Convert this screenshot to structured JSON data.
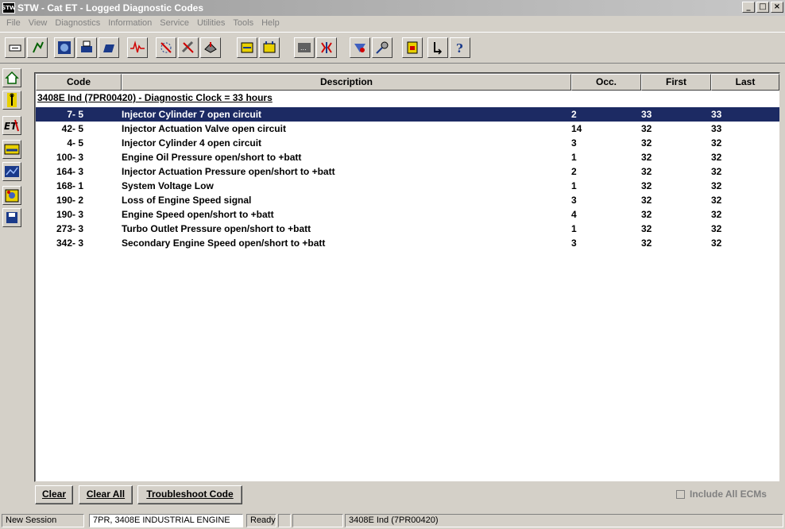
{
  "window": {
    "title": "STW - Cat ET - Logged Diagnostic Codes",
    "app_icon_text": "STW"
  },
  "menu": [
    "File",
    "View",
    "Diagnostics",
    "Information",
    "Service",
    "Utilities",
    "Tools",
    "Help"
  ],
  "toolbar_icons": [
    "minimize-window-icon",
    "connect-icon",
    "ecm-summary-icon",
    "printer-icon",
    "print-icon",
    "status-graph-icon",
    "clear-codes-icon",
    "tools-icon",
    "diagnostic-icon",
    "config-icon",
    "tests-icon",
    "calibration-icon",
    "flash-icon",
    "scale-icon",
    "settings-icon",
    "report-icon",
    "exit-icon",
    "help-icon"
  ],
  "sidebar_icons": [
    "home-icon",
    "wrench-icon",
    "et-icon",
    "status-icon",
    "graph-icon",
    "gear-person-icon",
    "save-icon"
  ],
  "table": {
    "columns": {
      "code": "Code",
      "description": "Description",
      "occ": "Occ.",
      "first": "First",
      "last": "Last"
    },
    "group": "3408E Ind (7PR00420) - Diagnostic Clock = 33 hours",
    "rows": [
      {
        "code": "7- 5",
        "description": "Injector Cylinder 7 open circuit",
        "occ": "2",
        "first": "33",
        "last": "33"
      },
      {
        "code": "42- 5",
        "description": "Injector Actuation Valve open circuit",
        "occ": "14",
        "first": "32",
        "last": "33"
      },
      {
        "code": "4- 5",
        "description": "Injector Cylinder 4 open circuit",
        "occ": "3",
        "first": "32",
        "last": "32"
      },
      {
        "code": "100- 3",
        "description": "Engine Oil Pressure open/short to +batt",
        "occ": "1",
        "first": "32",
        "last": "32"
      },
      {
        "code": "164- 3",
        "description": "Injector Actuation Pressure open/short to +batt",
        "occ": "2",
        "first": "32",
        "last": "32"
      },
      {
        "code": "168- 1",
        "description": "System Voltage Low",
        "occ": "1",
        "first": "32",
        "last": "32"
      },
      {
        "code": "190- 2",
        "description": "Loss of Engine Speed signal",
        "occ": "3",
        "first": "32",
        "last": "32"
      },
      {
        "code": "190- 3",
        "description": "Engine Speed open/short to +batt",
        "occ": "4",
        "first": "32",
        "last": "32"
      },
      {
        "code": "273- 3",
        "description": "Turbo Outlet Pressure open/short to +batt",
        "occ": "1",
        "first": "32",
        "last": "32"
      },
      {
        "code": "342- 3",
        "description": "Secondary Engine Speed open/short to +batt",
        "occ": "3",
        "first": "32",
        "last": "32"
      }
    ]
  },
  "buttons": {
    "clear": "Clear",
    "clear_all": "Clear All",
    "troubleshoot": "Troubleshoot Code"
  },
  "include_all_ecms": {
    "label": "Include All ECMs",
    "checked": false
  },
  "status": {
    "session": "New Session",
    "engine": "7PR, 3408E INDUSTRIAL ENGINE",
    "state": "Ready",
    "ecm": "3408E Ind (7PR00420)"
  },
  "colors": {
    "selected_row": "#1c2a63",
    "chrome": "#d4d0c8"
  }
}
